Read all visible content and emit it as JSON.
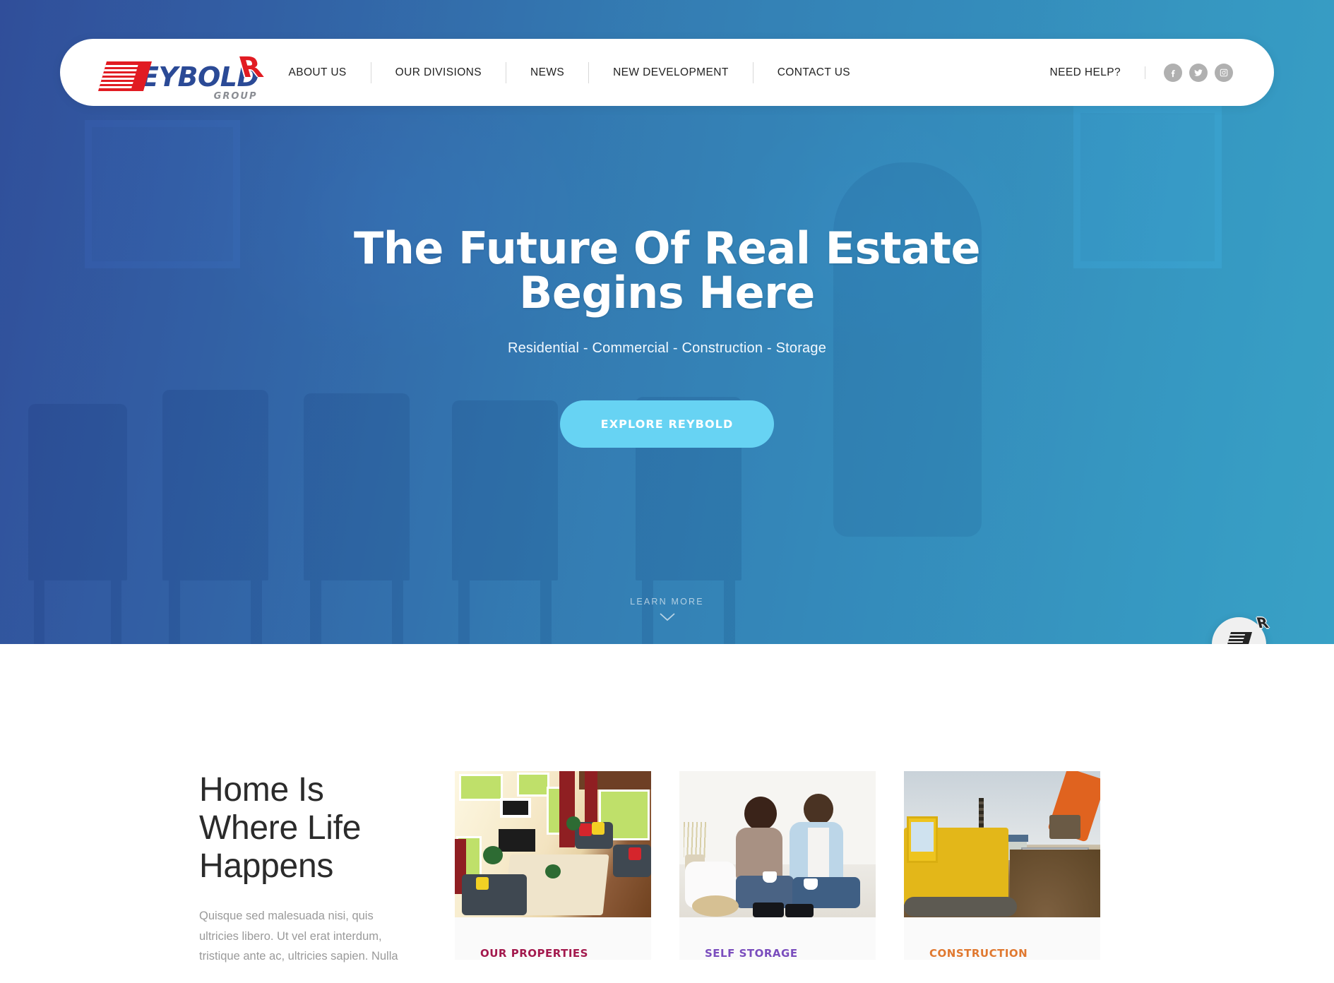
{
  "header": {
    "logo": {
      "mark_letter": "R",
      "word": "EYBOLD",
      "subtitle": "GROUP"
    },
    "nav": [
      {
        "label": "ABOUT US",
        "name": "nav-about-us"
      },
      {
        "label": "OUR DIVISIONS",
        "name": "nav-our-divisions"
      },
      {
        "label": "NEWS",
        "name": "nav-news"
      },
      {
        "label": "NEW DEVELOPMENT",
        "name": "nav-new-development"
      },
      {
        "label": "CONTACT US",
        "name": "nav-contact-us"
      }
    ],
    "need_help": "NEED HELP?",
    "socials": [
      {
        "name": "facebook-icon",
        "label": "Facebook"
      },
      {
        "name": "twitter-icon",
        "label": "Twitter"
      },
      {
        "name": "instagram-icon",
        "label": "Instagram"
      }
    ]
  },
  "hero": {
    "title_line1": "The Future Of Real Estate",
    "title_line2": "Begins Here",
    "subtitle": "Residential - Commercial - Construction - Storage",
    "cta_label": "EXPLORE REYBOLD",
    "cta_color": "#67d3f3",
    "scroll_label": "LEARN MORE",
    "overlay_from": "#2c4fa8",
    "overlay_to": "#34b2e2"
  },
  "floating_widget": {
    "name": "reybold-chat-widget",
    "mark_letter": "R",
    "dots": 3
  },
  "main": {
    "intro": {
      "title_line1": "Home Is",
      "title_line2": "Where Life",
      "title_line3": "Happens",
      "paragraph": "Quisque sed malesuada nisi, quis ultricies libero. Ut vel erat interdum, tristique ante ac, ultricies sapien. Nulla"
    },
    "cards": [
      {
        "label": "OUR PROPERTIES",
        "color": "#a3194d",
        "image_alt": "living-room-interior",
        "name": "card-our-properties"
      },
      {
        "label": "SELF STORAGE",
        "color": "#7a4dbd",
        "image_alt": "couple-on-couch",
        "name": "card-self-storage"
      },
      {
        "label": "CONSTRUCTION",
        "color": "#e0782f",
        "image_alt": "construction-site-equipment",
        "name": "card-construction"
      }
    ]
  }
}
